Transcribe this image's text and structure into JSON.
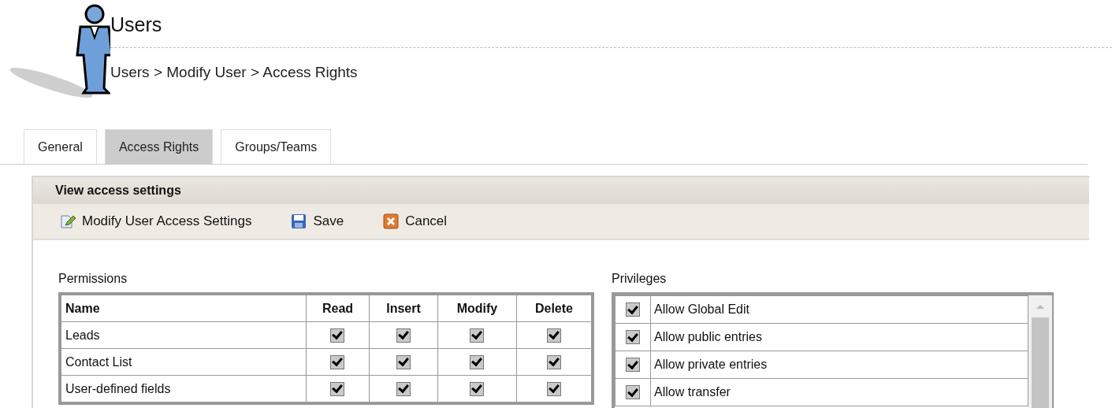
{
  "header": {
    "title": "Users",
    "breadcrumb": "Users > Modify User > Access Rights"
  },
  "tabs": [
    {
      "label": "General",
      "selected": false
    },
    {
      "label": "Access Rights",
      "selected": true
    },
    {
      "label": "Groups/Teams",
      "selected": false
    }
  ],
  "panel": {
    "title": "View access settings",
    "toolbar": [
      {
        "kind": "edit",
        "label": "Modify User Access Settings"
      },
      {
        "kind": "save",
        "label": "Save"
      },
      {
        "kind": "cancel",
        "label": "Cancel"
      }
    ]
  },
  "permissions": {
    "label": "Permissions",
    "columns": [
      "Name",
      "Read",
      "Insert",
      "Modify",
      "Delete"
    ],
    "rows": [
      {
        "name": "Leads",
        "checks": [
          true,
          true,
          true,
          true
        ]
      },
      {
        "name": "Contact List",
        "checks": [
          true,
          true,
          true,
          true
        ]
      },
      {
        "name": "User-defined fields",
        "checks": [
          true,
          true,
          true,
          true
        ]
      }
    ]
  },
  "privileges": {
    "label": "Privileges",
    "items": [
      {
        "label": "Allow Global Edit",
        "checked": true
      },
      {
        "label": "Allow public entries",
        "checked": true
      },
      {
        "label": "Allow private entries",
        "checked": true
      },
      {
        "label": "Allow transfer",
        "checked": true
      }
    ]
  }
}
